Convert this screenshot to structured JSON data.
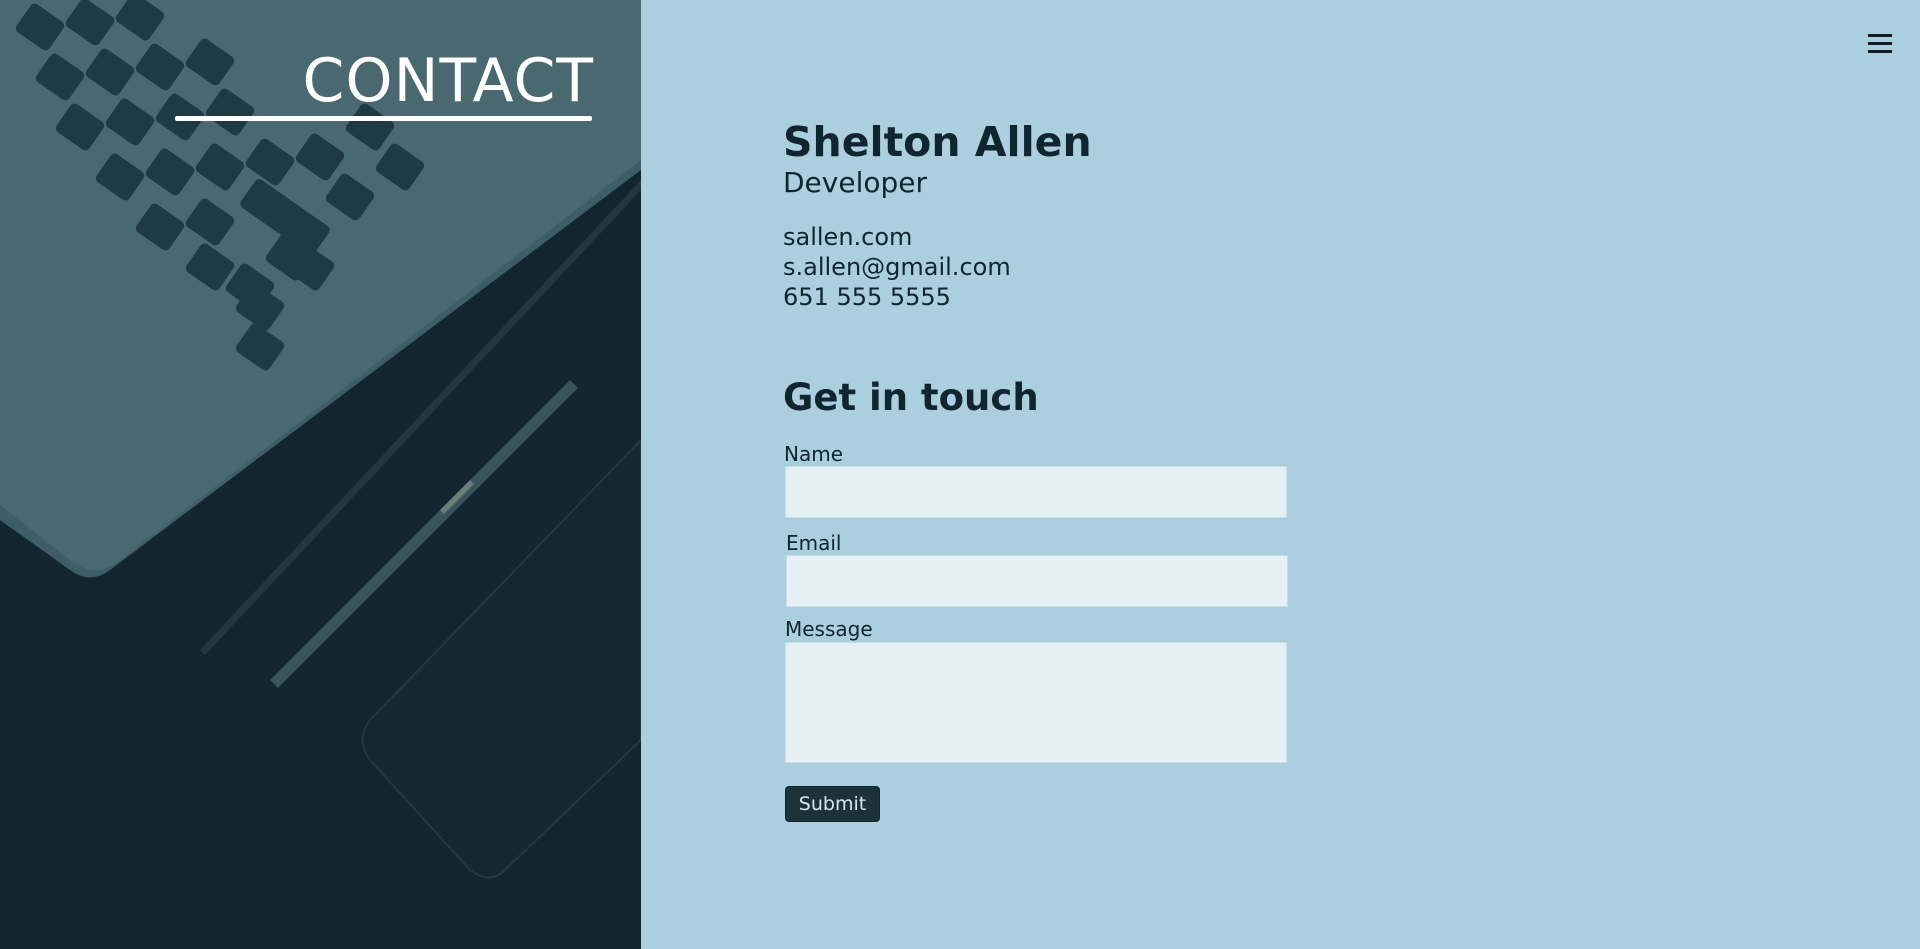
{
  "hero": {
    "title": "CONTACT",
    "image_description_icon": "laptop-keyboard-pen-photo"
  },
  "menu": {
    "icon": "hamburger-menu-icon"
  },
  "profile": {
    "name": "Shelton Allen",
    "role": "Developer",
    "website": "sallen.com",
    "email": "s.allen@gmail.com",
    "phone": "651 555 5555"
  },
  "form": {
    "heading": "Get in touch",
    "name_label": "Name",
    "name_value": "",
    "email_label": "Email",
    "email_value": "",
    "message_label": "Message",
    "message_value": "",
    "submit_label": "Submit"
  },
  "colors": {
    "panel_dark": "#11262e",
    "background": "#abcfdf",
    "field_bg": "#e6f0f5",
    "button_bg": "#1c323b",
    "text": "#0f2530"
  }
}
